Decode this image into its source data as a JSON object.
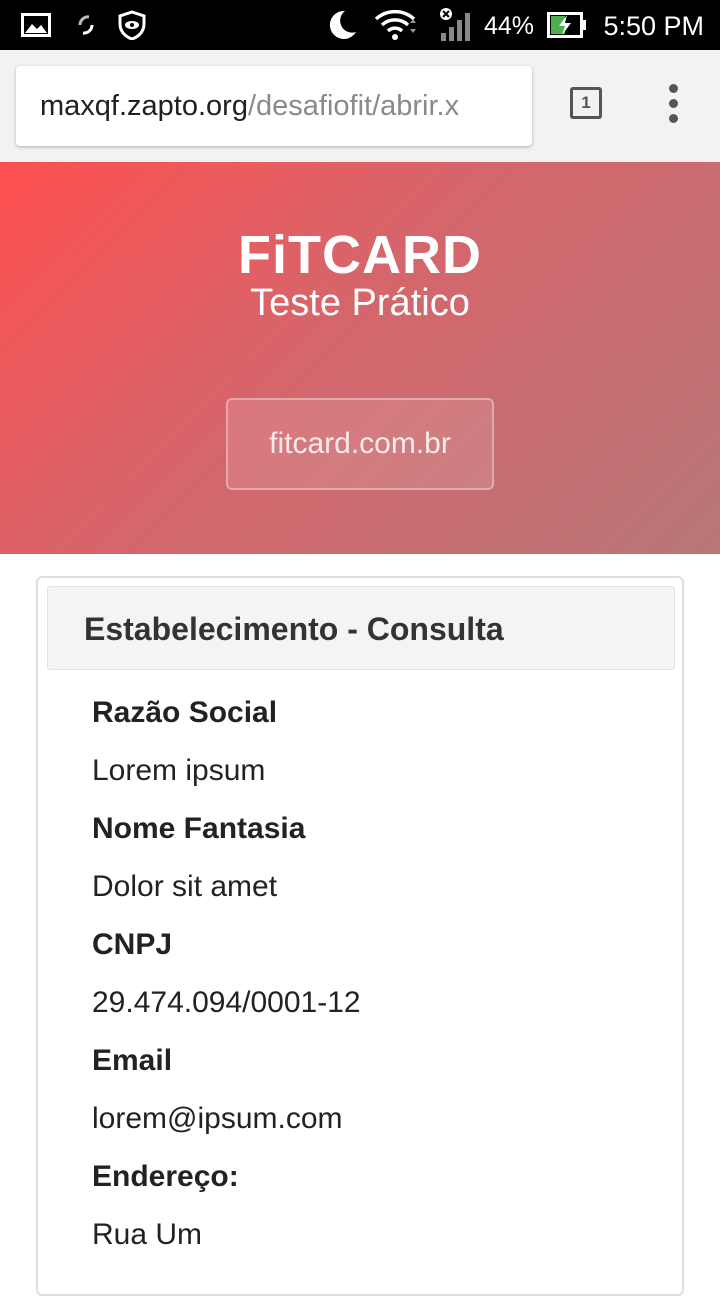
{
  "status_bar": {
    "battery_percent": "44%",
    "time": "5:50 PM",
    "icons": [
      "gallery-icon",
      "sync-icon",
      "eye-shield-icon",
      "moon-icon",
      "wifi-icon",
      "signal-icon",
      "battery-charging-icon"
    ]
  },
  "browser": {
    "url_host": "maxqf.zapto.org",
    "url_path": "/desafiofit/abrir.x",
    "tab_count": "1"
  },
  "hero": {
    "title": "FiTCARD",
    "subtitle": "Teste Prático",
    "link_label": "fitcard.com.br"
  },
  "card": {
    "title": "Estabelecimento - Consulta",
    "fields": [
      {
        "label": "Razão Social",
        "value": "Lorem ipsum"
      },
      {
        "label": "Nome Fantasia",
        "value": "Dolor sit amet"
      },
      {
        "label": "CNPJ",
        "value": "29.474.094/0001-12"
      },
      {
        "label": "Email",
        "value": "lorem@ipsum.com"
      },
      {
        "label": "Endereço:",
        "value": "Rua Um"
      }
    ]
  },
  "colors": {
    "hero_gradient_start": "#ff5050",
    "hero_gradient_end": "#b87676",
    "text": "#222222"
  }
}
